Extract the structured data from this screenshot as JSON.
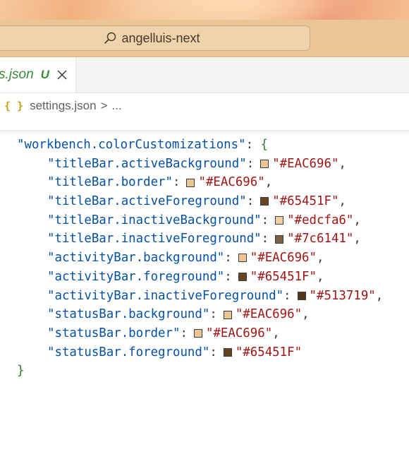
{
  "command_center": {
    "icon": "search-icon",
    "label": "angelluis-next"
  },
  "tab": {
    "filename": "s.json",
    "status": "U",
    "close_icon": "close-icon"
  },
  "breadcrumb": {
    "icon": "{ }",
    "file": "settings.json",
    "separator": ">",
    "more": "..."
  },
  "code": {
    "root_key": "\"workbench.colorCustomizations\"",
    "open_brace": "{",
    "close_brace": "}",
    "entries": [
      {
        "key": "\"titleBar.activeBackground\"",
        "value": "\"#EAC696\"",
        "color": "#EAC696",
        "comma": ","
      },
      {
        "key": "\"titleBar.border\"",
        "value": "\"#EAC696\"",
        "color": "#EAC696",
        "comma": ","
      },
      {
        "key": "\"titleBar.activeForeground\"",
        "value": "\"#65451F\"",
        "color": "#65451F",
        "comma": ","
      },
      {
        "key": "\"titleBar.inactiveBackground\"",
        "value": "\"#edcfa6\"",
        "color": "#edcfa6",
        "comma": ","
      },
      {
        "key": "\"titleBar.inactiveForeground\"",
        "value": "\"#7c6141\"",
        "color": "#7c6141",
        "comma": ","
      },
      {
        "key": "\"activityBar.background\"",
        "value": "\"#EAC696\"",
        "color": "#EAC696",
        "comma": ","
      },
      {
        "key": "\"activityBar.foreground\"",
        "value": "\"#65451F\"",
        "color": "#65451F",
        "comma": ","
      },
      {
        "key": "\"activityBar.inactiveForeground\"",
        "value": "\"#513719\"",
        "color": "#513719",
        "comma": ","
      },
      {
        "key": "\"statusBar.background\"",
        "value": "\"#EAC696\"",
        "color": "#EAC696",
        "comma": ","
      },
      {
        "key": "\"statusBar.border\"",
        "value": "\"#EAC696\"",
        "color": "#EAC696",
        "comma": ","
      },
      {
        "key": "\"statusBar.foreground\"",
        "value": "\"#65451F\"",
        "color": "#65451F",
        "comma": ""
      }
    ]
  },
  "colors": {
    "title_bar_bg": "#eac696",
    "key": "#0451a5",
    "string": "#a31515",
    "tab_modified": "#388a34"
  }
}
